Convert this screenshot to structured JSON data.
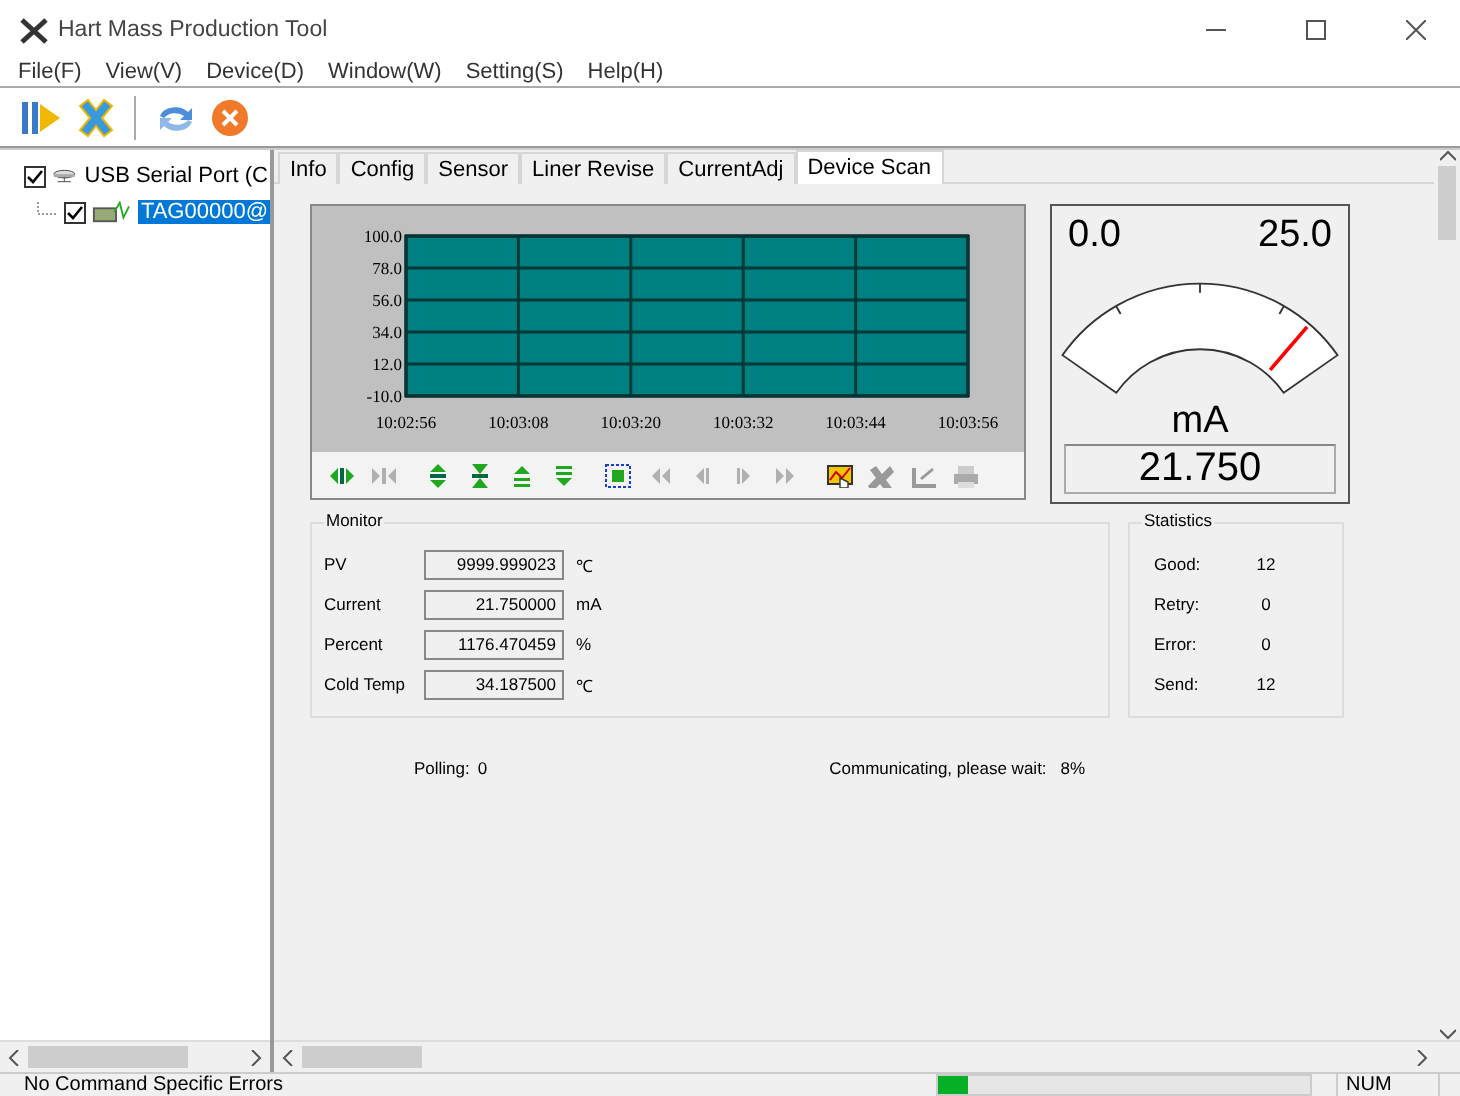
{
  "window": {
    "title": "Hart Mass Production Tool"
  },
  "menu": [
    "File(F)",
    "View(V)",
    "Device(D)",
    "Window(W)",
    "Setting(S)",
    "Help(H)"
  ],
  "tree": [
    {
      "label": "USB Serial Port (C",
      "checked": true,
      "selected": false,
      "children": [
        {
          "label": "TAG00000@",
          "checked": true,
          "selected": true
        }
      ]
    }
  ],
  "tabs": [
    {
      "label": "Info",
      "selected": false
    },
    {
      "label": "Config",
      "selected": false
    },
    {
      "label": "Sensor",
      "selected": false
    },
    {
      "label": "Liner Revise",
      "selected": false
    },
    {
      "label": "CurrentAdj",
      "selected": false
    },
    {
      "label": "Device Scan",
      "selected": true
    }
  ],
  "trend": {
    "chart_data": {
      "type": "line",
      "grid": true,
      "ylim": [
        -10,
        100
      ],
      "yticks": [
        {
          "value": 100,
          "label": "100.0"
        },
        {
          "value": 78,
          "label": "78.0"
        },
        {
          "value": 56,
          "label": "56.0"
        },
        {
          "value": 34,
          "label": "34.0"
        },
        {
          "value": 12,
          "label": "12.0"
        },
        {
          "value": -10,
          "label": "-10.0"
        }
      ],
      "categories": [
        "10:02:56",
        "10:03:08",
        "10:03:20",
        "10:03:32",
        "10:03:44",
        "10:03:56"
      ]
    }
  },
  "gauge": {
    "min": "0.0",
    "max": "25.0",
    "unit": "mA",
    "reading": "21.750"
  },
  "monitor": {
    "title": "Monitor",
    "rows": [
      {
        "label": "PV",
        "value": "9999.999023",
        "unit": "℃"
      },
      {
        "label": "Current",
        "value": "21.750000",
        "unit": "mA"
      },
      {
        "label": "Percent",
        "value": "1176.470459",
        "unit": "%"
      },
      {
        "label": "Cold Temp",
        "value": "34.187500",
        "unit": "℃"
      }
    ]
  },
  "statistics": {
    "title": "Statistics",
    "rows": [
      {
        "label": "Good:",
        "value": "12"
      },
      {
        "label": "Retry:",
        "value": "0"
      },
      {
        "label": "Error:",
        "value": "0"
      },
      {
        "label": "Send:",
        "value": "12"
      }
    ]
  },
  "polling": {
    "label": "Polling:",
    "value": "0"
  },
  "communicating": {
    "label": "Communicating, please wait:",
    "value": "8%"
  },
  "status_bar": {
    "message": "No Command Specific Errors",
    "progress": {
      "level": 0.08
    },
    "indicator": "NUM"
  }
}
